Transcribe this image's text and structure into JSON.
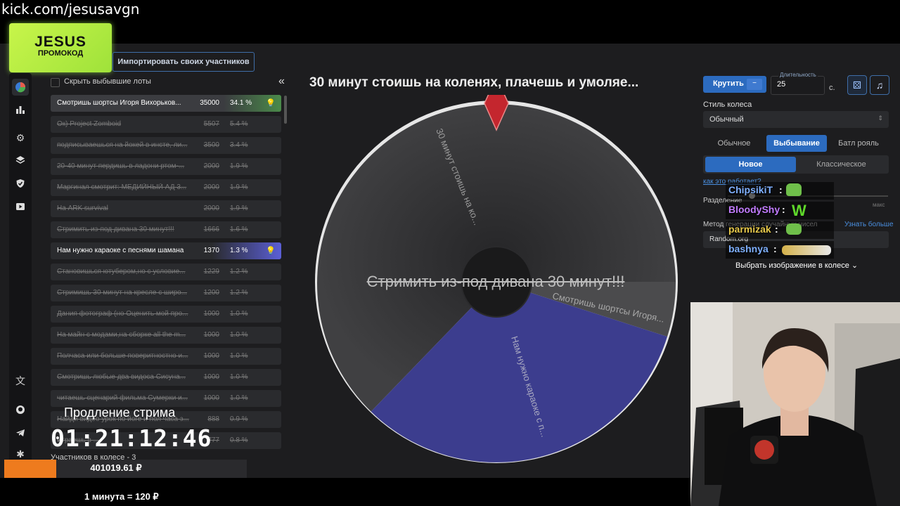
{
  "overlay": {
    "kick_url": "kick.com/jesusavgn",
    "promo_title": "JESUS",
    "promo_subtitle": "ПРОМОКОД",
    "extension_label": "Продление стрима",
    "timer": "01:21:12:46",
    "money": "401019.61 ₽",
    "rate": "1 минута = 120 ₽"
  },
  "toolbar": {
    "import_label": "Импортировать своих участников"
  },
  "sidebar": {
    "icons": [
      "pie-chart-icon",
      "bar-chart-icon",
      "gear-icon",
      "layers-icon",
      "shield-icon",
      "video-icon",
      "translate-icon",
      "github-icon",
      "telegram-icon",
      "bug-icon"
    ]
  },
  "list": {
    "hide_label": "Скрыть выбывшие лоты",
    "collapse": "«",
    "participants_label": "Участников в колесе - 3",
    "rows": [
      {
        "name": "Смотришь шортсы Игоря Вихорьков...",
        "amount": "35000",
        "pct": "34.1 %",
        "state": "green"
      },
      {
        "name": "Ок) Project Zomboid",
        "amount": "5507",
        "pct": "5.4 %",
        "state": "struck"
      },
      {
        "name": "подписываешься на йокей в инсте, ли...",
        "amount": "3500",
        "pct": "3.4 %",
        "state": "struck"
      },
      {
        "name": "20-40 минут пердишь в ладони ртом-...",
        "amount": "2000",
        "pct": "1.9 %",
        "state": "struck"
      },
      {
        "name": "Маргинал смотрит: МЕДИЙНЫЙ АД 3...",
        "amount": "2000",
        "pct": "1.9 %",
        "state": "struck"
      },
      {
        "name": "На ARK survival",
        "amount": "2000",
        "pct": "1.9 %",
        "state": "struck"
      },
      {
        "name": "Стримить из-под дивана 30 минут!!!",
        "amount": "1666",
        "pct": "1.6 %",
        "state": "struck"
      },
      {
        "name": "Нам нужно караоке с песнями шамана",
        "amount": "1370",
        "pct": "1.3 %",
        "state": "purple"
      },
      {
        "name": "Становишься ютубером,но с условие...",
        "amount": "1229",
        "pct": "1.2 %",
        "state": "struck"
      },
      {
        "name": "Стримишь 30 минут на кресле с широ...",
        "amount": "1200",
        "pct": "1.2 %",
        "state": "struck"
      },
      {
        "name": "Дания фотограф (но Оценить мой про...",
        "amount": "1000",
        "pct": "1.0 %",
        "state": "struck"
      },
      {
        "name": "На майн с модами,на сборке all the m...",
        "amount": "1000",
        "pct": "1.0 %",
        "state": "struck"
      },
      {
        "name": "Полчаса или больше поверитностно и...",
        "amount": "1000",
        "pct": "1.0 %",
        "state": "struck"
      },
      {
        "name": "Смотришь любые два видоса Сисуна...",
        "amount": "1000",
        "pct": "1.0 %",
        "state": "struck"
      },
      {
        "name": "читаешь сценарий фильма Сумерки и...",
        "amount": "1000",
        "pct": "1.0 %",
        "state": "struck"
      },
      {
        "name": "Найди видео урок по йоге и пол часа з...",
        "amount": "888",
        "pct": "0.9 %",
        "state": "struck"
      },
      {
        "name": "Играешь в ...",
        "amount": "777",
        "pct": "0.8 %",
        "state": "struck"
      }
    ]
  },
  "wheel": {
    "title": "30 минут стоишь на коленях, плачешь и умоляе...",
    "center_label": "Стримить из-под дивана 30 минут!!!",
    "segments": [
      {
        "label": "30 минут стоишь на ко...",
        "color": "#3a3a3c"
      },
      {
        "label": "Смотришь шортсы Игоря...",
        "color": "#4a4a4c"
      },
      {
        "label": "Нам нужно караоке с п...",
        "color": "#3d3e8c"
      }
    ]
  },
  "controls": {
    "spin_label": "Крутить",
    "spin_sub": "−",
    "duration_caption": "Длительность",
    "duration_value": "25",
    "duration_unit": "с.",
    "style_label": "Стиль колеса",
    "style_value": "Обычный",
    "mode_tabs": [
      "Обычное",
      "Выбывание",
      "Батл рояль"
    ],
    "mode_selected": 1,
    "sub_tabs": [
      "Новое",
      "Классическое"
    ],
    "sub_selected": 0,
    "how_link": "как это работает?",
    "split_label": "Разделение",
    "max_label": "макс",
    "method_label": "Метод генерации случайных чисел",
    "learn_more": "Узнать больше",
    "method_value": "Random.org",
    "choose_image": "Выбрать изображение в колесе"
  },
  "chat": [
    {
      "name": "ChipsikiT",
      "color": "#7fb0ff"
    },
    {
      "name": "BloodyShy",
      "color": "#c27cff"
    },
    {
      "name": "parmizak",
      "color": "#e6c84a"
    },
    {
      "name": "bashnya",
      "color": "#7fb0ff"
    }
  ],
  "colors": {
    "accent": "#2c6bbf",
    "promo": "#b7ee45",
    "orange": "#ee7b1e"
  }
}
